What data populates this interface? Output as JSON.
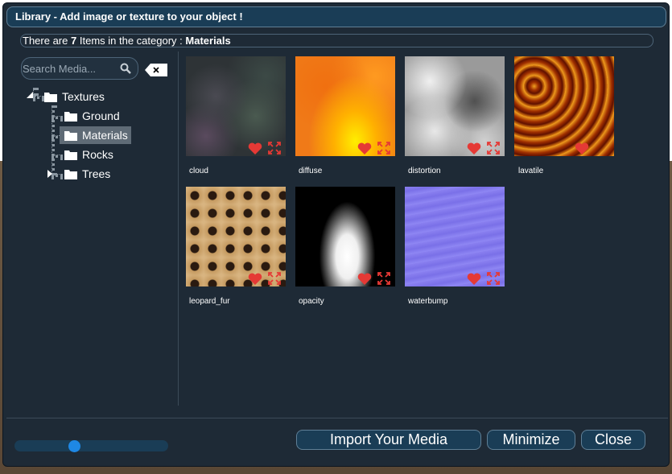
{
  "window": {
    "title": "Library - Add image or texture to your object !"
  },
  "info": {
    "prefix": "There are",
    "count": "7",
    "middle": "Items in the category :",
    "category": "Materials"
  },
  "search": {
    "placeholder": "Search Media..."
  },
  "tree": {
    "root": "Textures",
    "children": [
      "Ground",
      "Materials",
      "Rocks",
      "Trees"
    ],
    "selected": "Materials"
  },
  "media": [
    {
      "name": "cloud"
    },
    {
      "name": "diffuse"
    },
    {
      "name": "distortion"
    },
    {
      "name": "lavatile"
    },
    {
      "name": "leopard_fur"
    },
    {
      "name": "opacity"
    },
    {
      "name": "waterbump"
    }
  ],
  "footer": {
    "import_label": "Import Your Media",
    "minimize_label": "Minimize",
    "close_label": "Close",
    "zoom_level": 0.4
  },
  "colors": {
    "titlebar": "#1a3d56",
    "panel": "#1e2a36",
    "accent": "#1e88e5",
    "favorite": "#e53935",
    "selected": "#5f6b76"
  }
}
